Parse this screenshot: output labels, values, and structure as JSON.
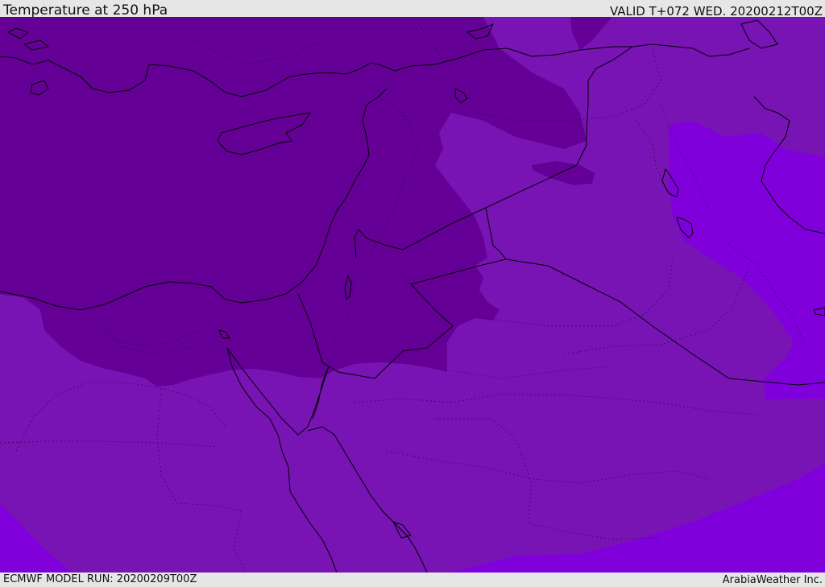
{
  "header": {
    "title": "Temperature at 250 hPa",
    "valid": "VALID T+072 WED. 20200212T00Z"
  },
  "footer": {
    "model_run": "ECMWF MODEL RUN: 20200209T00Z",
    "credit": "ArabiaWeather Inc."
  },
  "map": {
    "colors": {
      "cold_band": "#640096",
      "mid_band": "#7814b4",
      "warm_band": "#8000dc",
      "coastline": "#000000",
      "header_bg": "#e6e6e6"
    }
  }
}
